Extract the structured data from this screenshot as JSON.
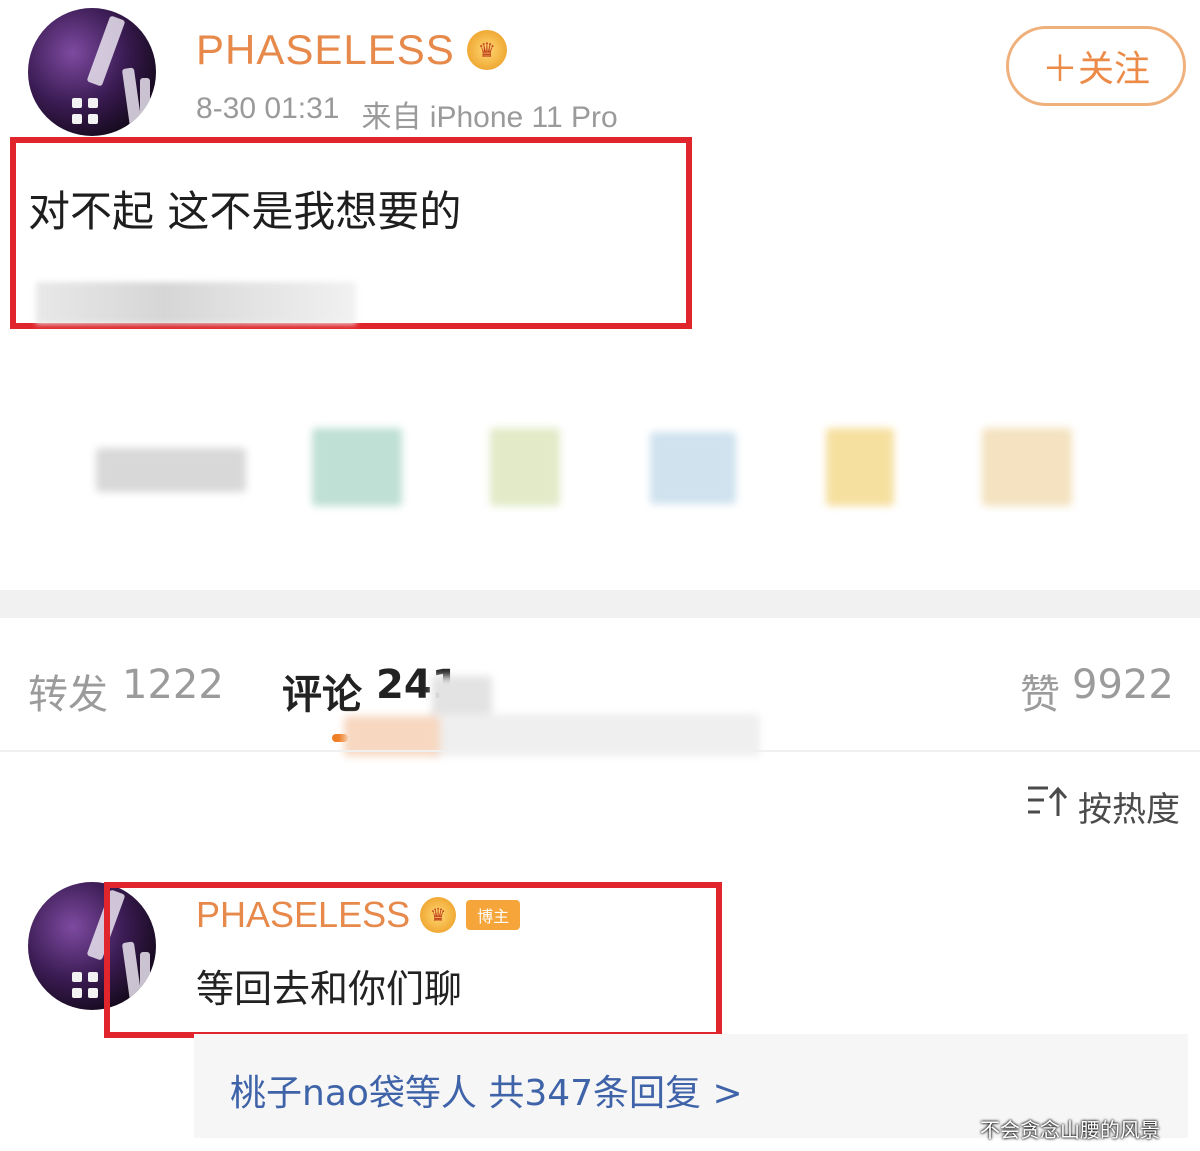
{
  "post": {
    "username": "PHASELESS",
    "vip_icon": "vip-crown-icon",
    "timestamp": "8-30 01:31",
    "source": "来自 iPhone 11 Pro",
    "follow_label": "＋关注",
    "text": "对不起 这不是我想要的"
  },
  "stats": {
    "repost_label": "转发",
    "repost_count": "1222",
    "comment_label": "评论",
    "comment_count": "241",
    "like_label": "赞",
    "like_count": "9922"
  },
  "sort": {
    "icon": "sort-icon",
    "label": "按热度"
  },
  "comment": {
    "username": "PHASELESS",
    "badge": "博主",
    "text": "等回去和你们聊",
    "replies_label": "桃子nao袋等人 共347条回复 >"
  },
  "watermark": "不会贪念山腰的风景",
  "colors": {
    "accent_orange": "#e6894a",
    "highlight_red": "#e0262c",
    "link_blue": "#3f63a8"
  }
}
